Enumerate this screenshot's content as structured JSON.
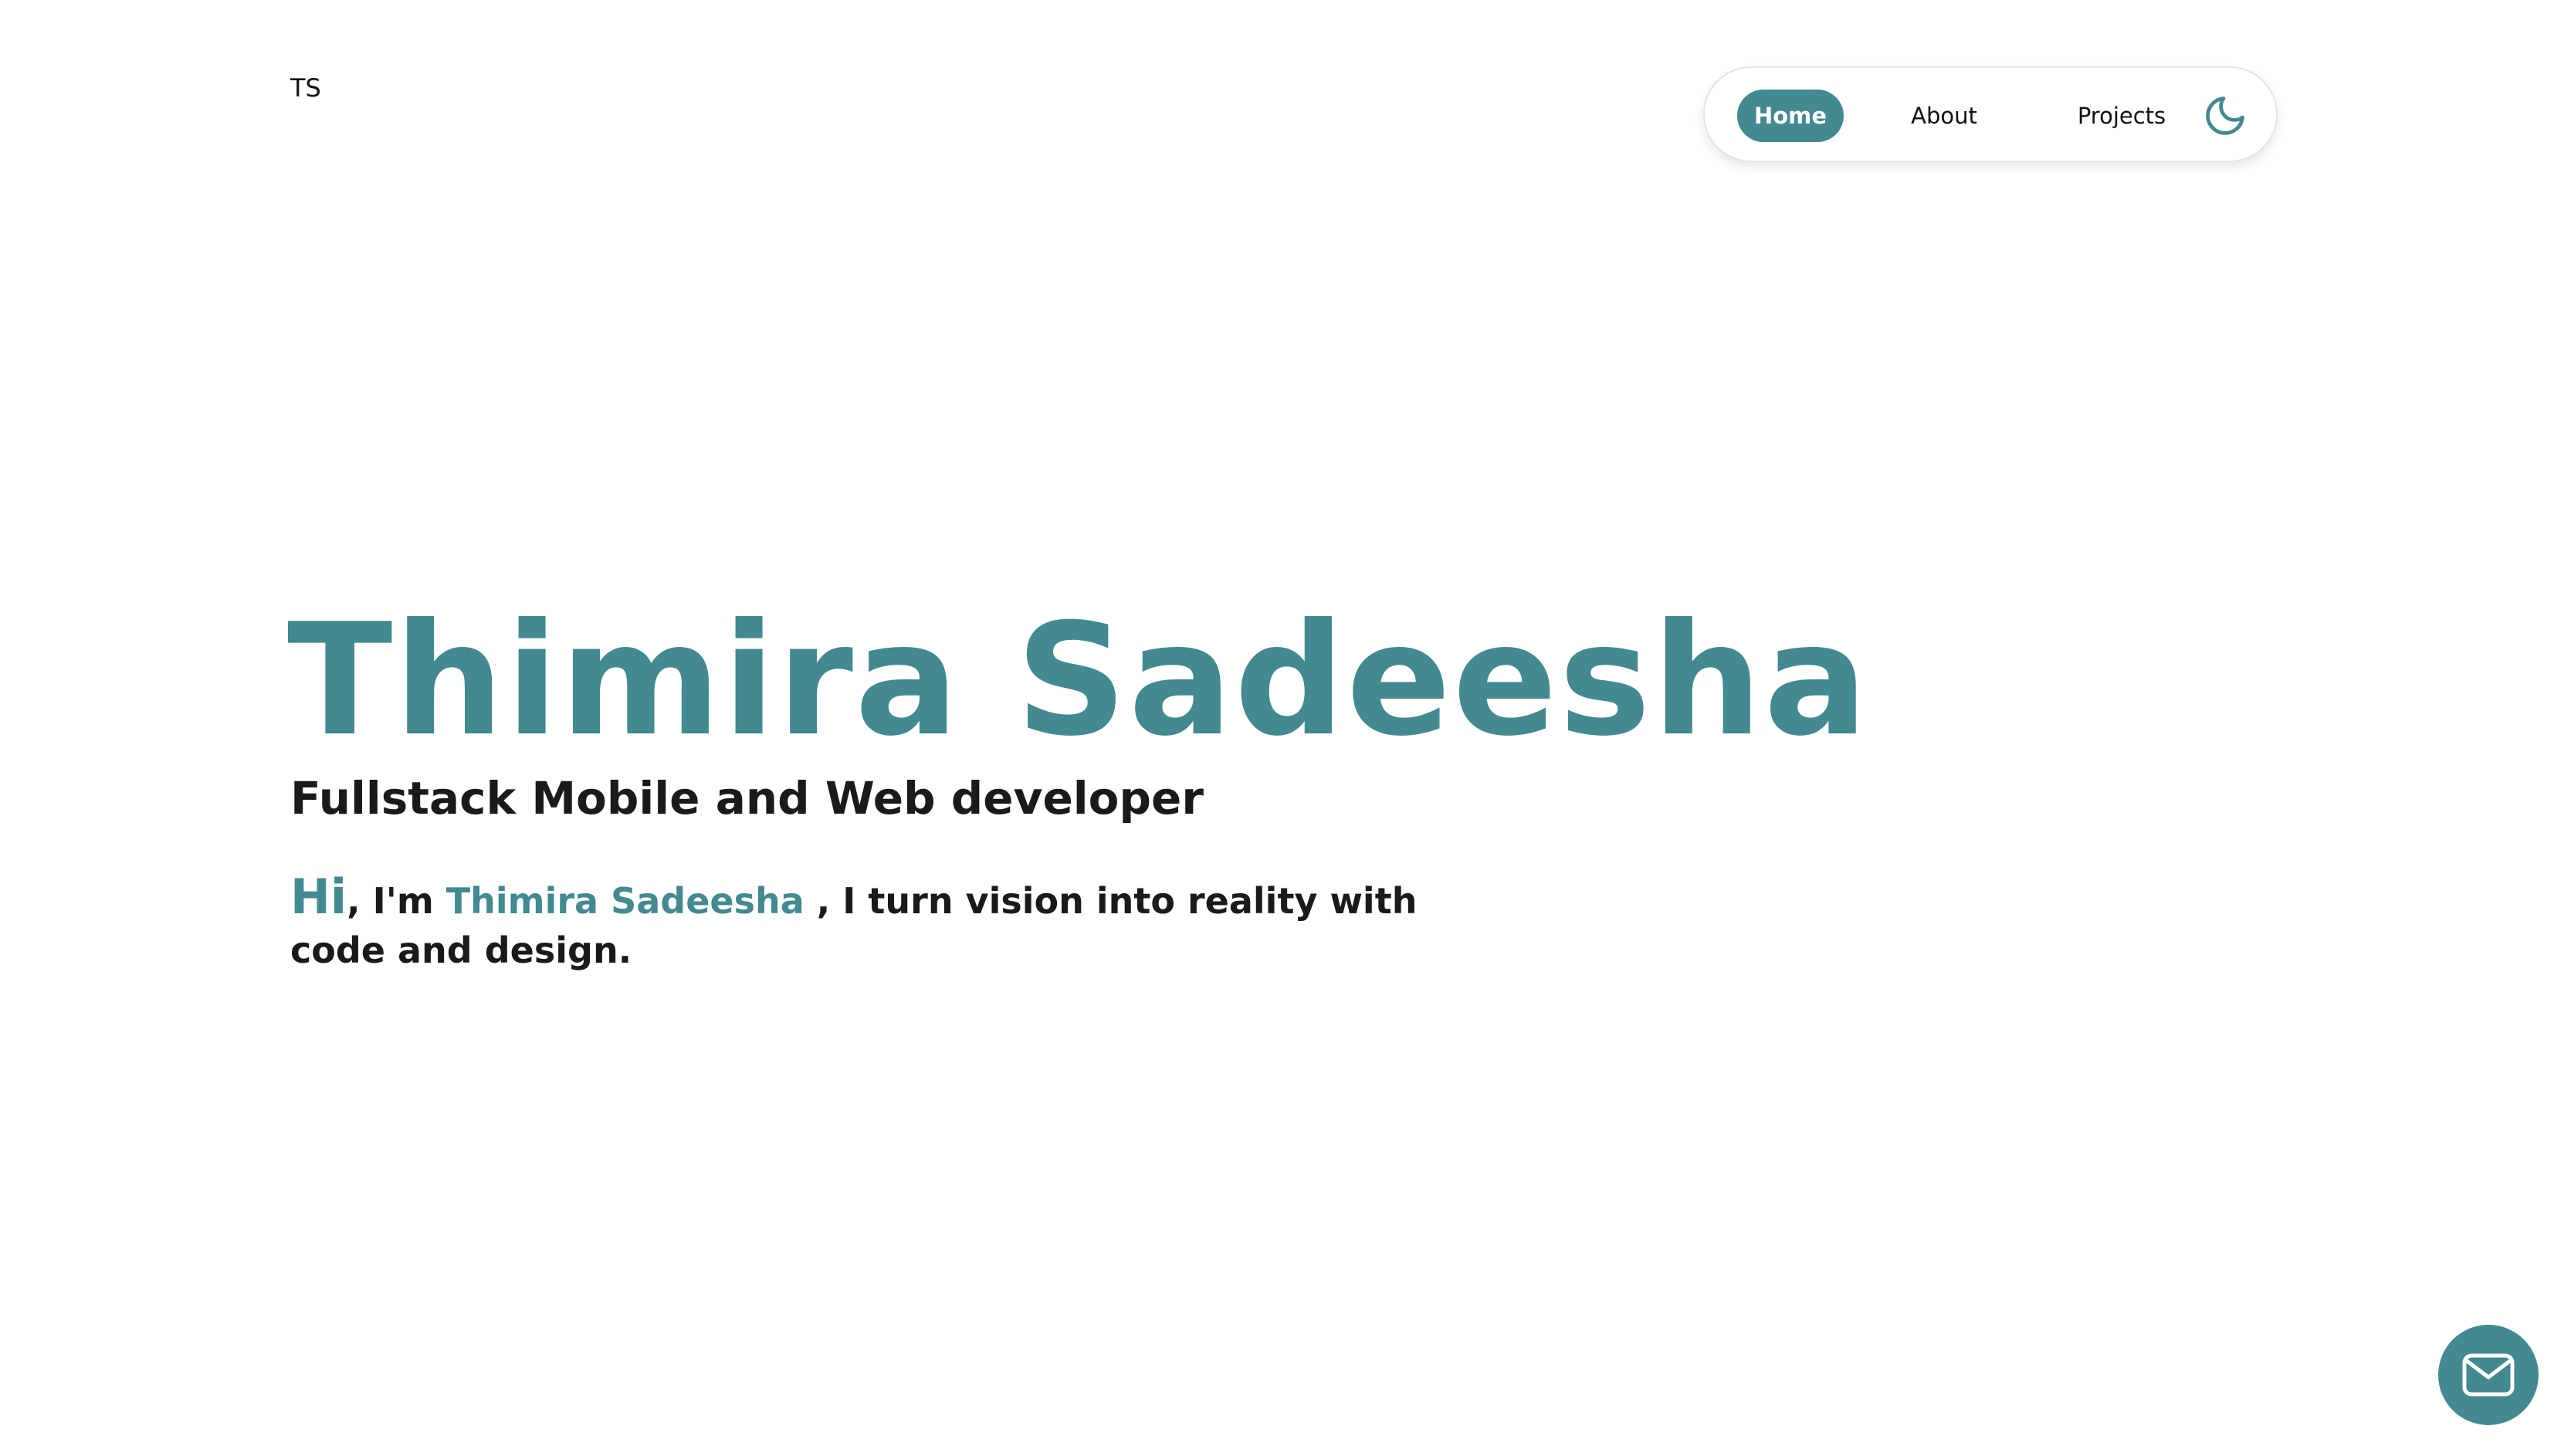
{
  "header": {
    "logo": "TS",
    "nav": {
      "items": [
        {
          "label": "Home",
          "active": true
        },
        {
          "label": "About",
          "active": false
        },
        {
          "label": "Projects",
          "active": false
        }
      ],
      "theme_toggle_icon": "moon-icon"
    }
  },
  "hero": {
    "name": "Thimira Sadeesha",
    "subtitle": "Fullstack Mobile and Web developer",
    "intro": {
      "hi": "Hi",
      "im": ", I'm ",
      "name": "Thimira Sadeesha",
      "rest": " , I turn vision into reality with code and design."
    }
  },
  "contact_button": {
    "icon": "mail-icon"
  },
  "colors": {
    "accent": "#438990",
    "text": "#1a1a1a",
    "background": "#ffffff"
  }
}
